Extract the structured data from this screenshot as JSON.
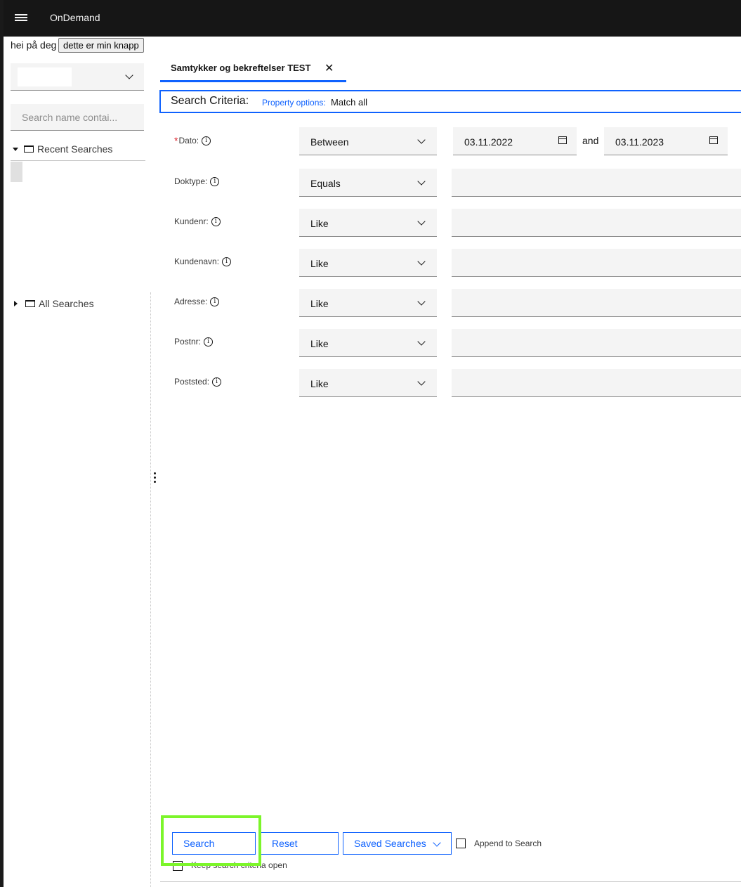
{
  "header": {
    "app_title": "OnDemand"
  },
  "custom": {
    "greeting": "hei på deg",
    "button_label": "dette er min knapp"
  },
  "sidebar": {
    "search_placeholder": "Search name contai...",
    "recent_searches": "Recent Searches",
    "all_searches": "All Searches"
  },
  "tab": {
    "label": "Samtykker og bekreftelser TEST"
  },
  "criteria": {
    "title": "Search Criteria:",
    "property_options_label": "Property options:",
    "property_options_value": "Match all",
    "date": {
      "label": "Dato:",
      "operator": "Between",
      "from": "03.11.2022",
      "and": "and",
      "to": "03.11.2023"
    },
    "fields": [
      {
        "label": "Doktype:",
        "operator": "Equals",
        "value": ""
      },
      {
        "label": "Kundenr:",
        "operator": "Like",
        "value": ""
      },
      {
        "label": "Kundenavn:",
        "operator": "Like",
        "value": ""
      },
      {
        "label": "Adresse:",
        "operator": "Like",
        "value": ""
      },
      {
        "label": "Postnr:",
        "operator": "Like",
        "value": ""
      },
      {
        "label": "Poststed:",
        "operator": "Like",
        "value": ""
      }
    ]
  },
  "actions": {
    "search": "Search",
    "reset": "Reset",
    "saved_searches": "Saved Searches",
    "append_to_search": "Append to Search",
    "keep_open": "Keep search criteria open"
  },
  "colors": {
    "accent": "#0f62fe",
    "header_bg": "#161616",
    "highlight": "#7cf52a",
    "required": "#da1e28"
  }
}
